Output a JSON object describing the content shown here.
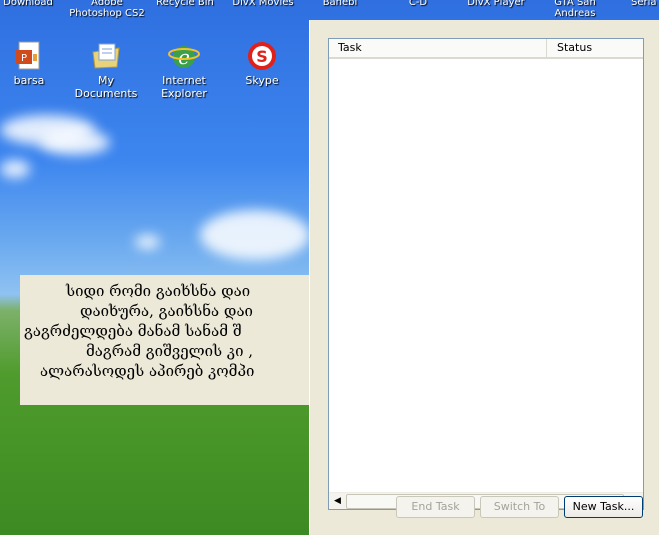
{
  "desktop": {
    "top_labels": [
      {
        "text": "Download"
      },
      {
        "text": "Adobe\nPhotoshop CS2"
      },
      {
        "text": "Recycle Bin"
      },
      {
        "text": "DivX Movies"
      },
      {
        "text": "Banebi"
      },
      {
        "text": "C-D"
      },
      {
        "text": "DivX Player"
      },
      {
        "text": "GTA San\nAndreas"
      },
      {
        "text": "Seria"
      }
    ],
    "icons": [
      {
        "label": "barsa",
        "icon": "powerpoint-file-icon",
        "color": "#d04a1c"
      },
      {
        "label": "My Documents",
        "icon": "documents-folder-icon",
        "color": "#e8d27a"
      },
      {
        "label": "Internet\nExplorer",
        "icon": "internet-explorer-icon",
        "color": "#2f8f2f"
      },
      {
        "label": "Skype",
        "icon": "skype-icon",
        "color": "#e0201a"
      }
    ]
  },
  "note": {
    "lines": [
      "სიდი რომი გაიხსნა დაი",
      "დაიხურა, გაიხსნა დაი",
      "გაგრძელდება მანამ სანამ შ",
      "მაგრამ გიშველის კი ,",
      "ალარასოდეს აპირებ კომპი"
    ]
  },
  "task_manager": {
    "columns": {
      "task": "Task",
      "status": "Status"
    },
    "rows": [],
    "buttons": {
      "end_task": "End Task",
      "switch_to": "Switch To",
      "new_task": "New Task..."
    }
  }
}
